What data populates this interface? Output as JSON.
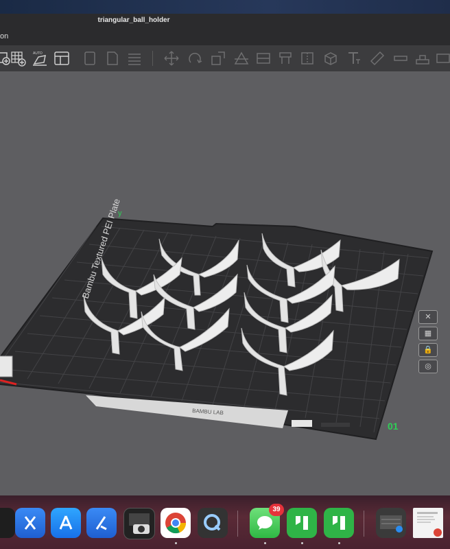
{
  "window": {
    "title": "triangular_ball_holder",
    "menu_label": "on"
  },
  "plate": {
    "label": "Bambu Textured PEI Plate",
    "number": "01",
    "axis_label": "y",
    "info_strip": "BAMBU LAB"
  },
  "side_tools": [
    "✕",
    "▦",
    "🔒",
    "◎"
  ],
  "toolbar": {
    "icons": [
      "add-plate-icon",
      "arrange-grid-icon",
      "auto-orient-icon",
      "layout-icon",
      "copy-icon",
      "paste-icon",
      "layers-icon",
      "move-icon",
      "rotate-icon",
      "scale-icon",
      "cut-icon",
      "lay-on-face-icon",
      "support-paint-icon",
      "seam-paint-icon",
      "text-icon",
      "measure-icon",
      "assembly-icon"
    ]
  },
  "dock": {
    "apps": [
      {
        "name": "unknown-app",
        "color": "#222"
      },
      {
        "name": "xcode",
        "color": "#2e6fe0"
      },
      {
        "name": "app-store",
        "color": "#2a8cf0"
      },
      {
        "name": "simulator",
        "color": "#3b7ff0"
      },
      {
        "name": "photo-booth",
        "color": "#b33"
      },
      {
        "name": "chrome",
        "color": "#ffffff"
      },
      {
        "name": "quicktime",
        "color": "#1a3a6a"
      },
      {
        "name": "messages",
        "color": "#3dcf55",
        "badge": "39"
      },
      {
        "name": "bambu-studio",
        "color": "#32b44a"
      },
      {
        "name": "bambu-studio-2",
        "color": "#32b44a"
      },
      {
        "name": "mission-control",
        "color": "#444"
      },
      {
        "name": "document-preview",
        "color": "#f4f4f4"
      }
    ]
  },
  "colors": {
    "accent_green": "#2fd057",
    "plate": "#2f2f31",
    "part": "#e4e4e4"
  }
}
